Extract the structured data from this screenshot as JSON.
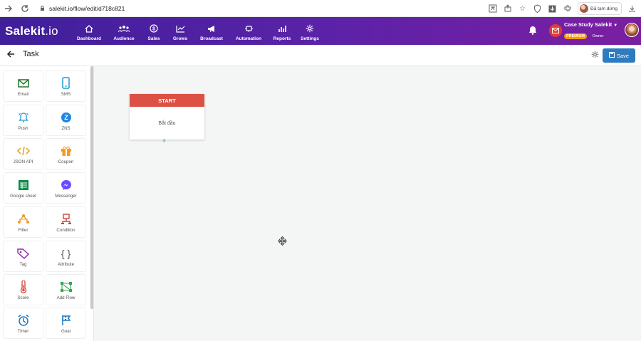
{
  "browser": {
    "url": "salekit.io/flow/edit/d718c821",
    "paused_label": "Đã tạm dừng",
    "icons": [
      "arrow-right-icon",
      "reload-icon",
      "lock-icon",
      "translate-icon",
      "share-icon",
      "star-icon",
      "shield-icon",
      "download-icon",
      "extension-icon",
      "download-tray-icon"
    ]
  },
  "header": {
    "logo": "Salekit",
    "logo_suffix": ".io",
    "nav": [
      {
        "label": "Dashboard",
        "icon": "home-icon"
      },
      {
        "label": "Audience",
        "icon": "people-icon"
      },
      {
        "label": "Sales",
        "icon": "dollar-icon"
      },
      {
        "label": "Grows",
        "icon": "growth-icon"
      },
      {
        "label": "Broadcast",
        "icon": "megaphone-icon"
      },
      {
        "label": "Automation",
        "icon": "automation-icon"
      },
      {
        "label": "Reports",
        "icon": "report-chart-icon"
      },
      {
        "label": "Settings",
        "icon": "settings-icon"
      }
    ],
    "account_name": "Case Study Salekit",
    "badge": "PREMIUM",
    "role": "Owner",
    "accent_color": "#5a22a8"
  },
  "toolbar": {
    "title": "Task",
    "save_label": "Save"
  },
  "sidebar": {
    "items": [
      {
        "label": "Email",
        "icon": "email-icon",
        "color": "#2e7d32"
      },
      {
        "label": "SMS",
        "icon": "phone-icon",
        "color": "#1d9bd7"
      },
      {
        "label": "Push",
        "icon": "bell-icon",
        "color": "#1d9bd7"
      },
      {
        "label": "ZNS",
        "icon": "zalo-icon",
        "color": "#1e88e5"
      },
      {
        "label": "JSON API",
        "icon": "code-icon",
        "color": "#e3a52f"
      },
      {
        "label": "Coupon",
        "icon": "gift-icon",
        "color": "#f39c22"
      },
      {
        "label": "Google sheet",
        "icon": "sheet-icon",
        "color": "#0f8b47"
      },
      {
        "label": "Messenger",
        "icon": "messenger-icon",
        "color": "#6b4cff"
      },
      {
        "label": "Filter",
        "icon": "filter-icon",
        "color": "#f39c22"
      },
      {
        "label": "Condition",
        "icon": "condition-icon",
        "color": "#c8443a"
      },
      {
        "label": "Tag",
        "icon": "tag-icon",
        "color": "#8e24aa"
      },
      {
        "label": "Attribute",
        "icon": "braces-icon",
        "color": "#555555"
      },
      {
        "label": "Score",
        "icon": "thermometer-icon",
        "color": "#d64d45"
      },
      {
        "label": "Add Flow",
        "icon": "add-flow-icon",
        "color": "#32a852"
      },
      {
        "label": "Timer",
        "icon": "alarm-icon",
        "color": "#1d78c6"
      },
      {
        "label": "Goal",
        "icon": "flag-icon",
        "color": "#1d78c6"
      }
    ]
  },
  "canvas": {
    "start_node": {
      "title": "START",
      "text": "Bắt đầu",
      "header_color": "#dd5145"
    }
  }
}
